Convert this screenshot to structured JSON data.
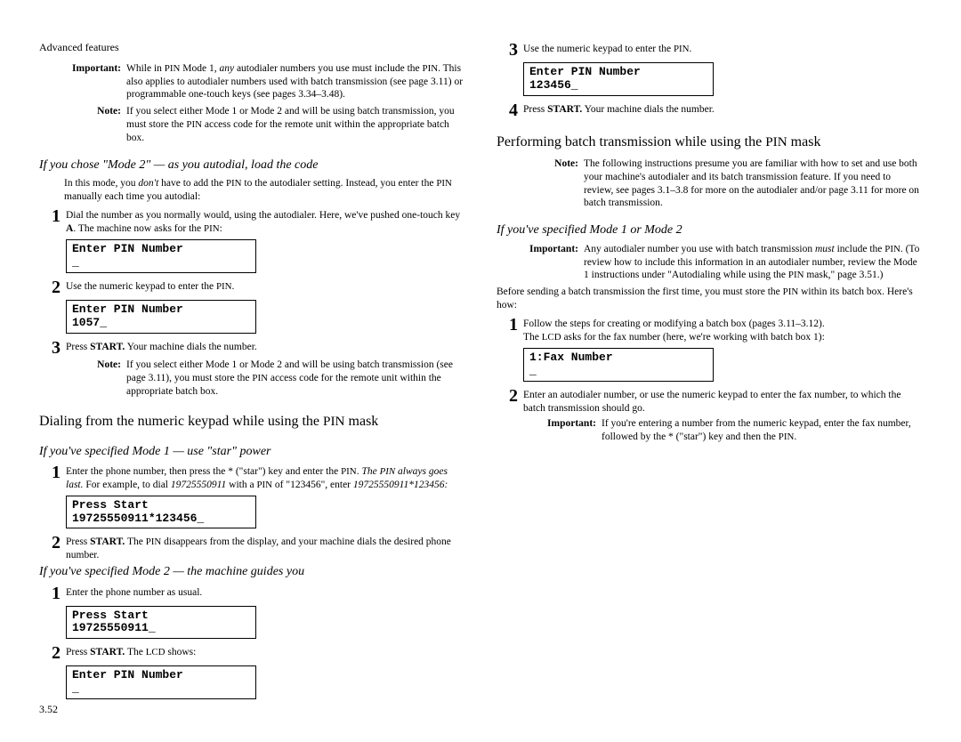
{
  "header": "Advanced features",
  "page_number": "3.52",
  "col1": {
    "important": {
      "label": "Important:",
      "text": "While in PIN Mode 1, any autodialer numbers you use must include the PIN. This also applies to autodialer numbers used with batch transmission (see page 3.11) or programmable one-touch keys (see pages 3.34–3.48)."
    },
    "note1": {
      "label": "Note:",
      "text": "If you select either Mode 1 or Mode 2 and will be using batch transmission, you must store the PIN access code for the remote unit within the appropriate batch box."
    },
    "sub1": "If you chose \"Mode 2\" — as you autodial, load the code",
    "intro1a": "In this mode, you ",
    "intro1b": "don't",
    "intro1c": " have to add the PIN to the autodialer setting. Instead, you enter the PIN manually each time you autodial:",
    "s1": {
      "n": "1",
      "t": "Dial the number as you normally would, using the autodialer. Here, we've pushed one-touch key A. The machine now asks for the PIN:"
    },
    "lcd1": "Enter PIN Number\n_",
    "s2": {
      "n": "2",
      "t": "Use the numeric keypad to enter the PIN."
    },
    "lcd2": "Enter PIN Number\n1057_",
    "s3": {
      "n": "3",
      "t": "Press START. Your machine dials the number."
    },
    "note2": {
      "label": "Note:",
      "text": "If you select either Mode 1 or Mode 2 and will be using batch transmission (see page 3.11), you must store the PIN access code for the remote unit within the appropriate batch box."
    },
    "section2": "Dialing from the numeric keypad while using the PIN mask",
    "sub2": "If you've specified Mode 1 — use \"star\" power",
    "s4": {
      "n": "1",
      "a": "Enter the phone number, then press the * (\"star\") key and enter the PIN. ",
      "b": "The PIN always goes last.",
      "c": " For example, to dial ",
      "d": "19725550911",
      "e": " with a PIN of \"123456\", enter ",
      "f": "19725550911*123456:"
    },
    "lcd3": "Press Start\n19725550911*123456_",
    "s5": {
      "n": "2",
      "t": "Press START. The PIN disappears from the display, and your machine dials the desired phone number."
    }
  },
  "col2": {
    "sub3": "If you've specified Mode 2 — the machine guides you",
    "r1": {
      "n": "1",
      "t": "Enter the phone number as usual."
    },
    "lcd4": "Press Start\n19725550911_",
    "r2": {
      "n": "2",
      "t": "Press START. The LCD shows:"
    },
    "lcd5": "Enter PIN Number\n_",
    "r3": {
      "n": "3",
      "t": "Use the numeric keypad to enter the PIN."
    },
    "lcd6": "Enter PIN Number\n123456_",
    "r4": {
      "n": "4",
      "t": "Press START. Your machine dials the number."
    },
    "section3": "Performing batch transmission while using the PIN mask",
    "note3": {
      "label": "Note:",
      "text": "The following instructions presume you are familiar with how to set and use both your machine's autodialer and its batch transmission feature. If you need to review, see pages 3.1–3.8 for more on the autodialer and/or page 3.11 for more on batch transmission."
    },
    "sub4": "If you've specified Mode 1 or Mode 2",
    "imp2": {
      "label": "Important:",
      "a": "Any autodialer number you use with batch transmission ",
      "b": "must",
      "c": " include the PIN. (To review how to include this information in an autodialer number, review the Mode 1 instructions under \"Autodialing while using the PIN mask,\" page 3.51.)"
    },
    "para2": "Before sending a batch transmission the first time, you must store the PIN within its batch box. Here's how:",
    "b1": {
      "n": "1",
      "a": "Follow the steps for creating or modifying a batch box (pages 3.11–3.12).",
      "b": "The LCD asks for the fax number (here, we're working with batch box 1):"
    },
    "lcd7": "1:Fax Number\n_",
    "b2": {
      "n": "2",
      "t": "Enter an autodialer number, or use the numeric keypad to enter the fax number, to which the batch transmission should go."
    },
    "imp3": {
      "label": "Important:",
      "text": "If you're entering a number from the numeric keypad, enter the fax number, followed by the * (\"star\") key and then the PIN."
    }
  }
}
